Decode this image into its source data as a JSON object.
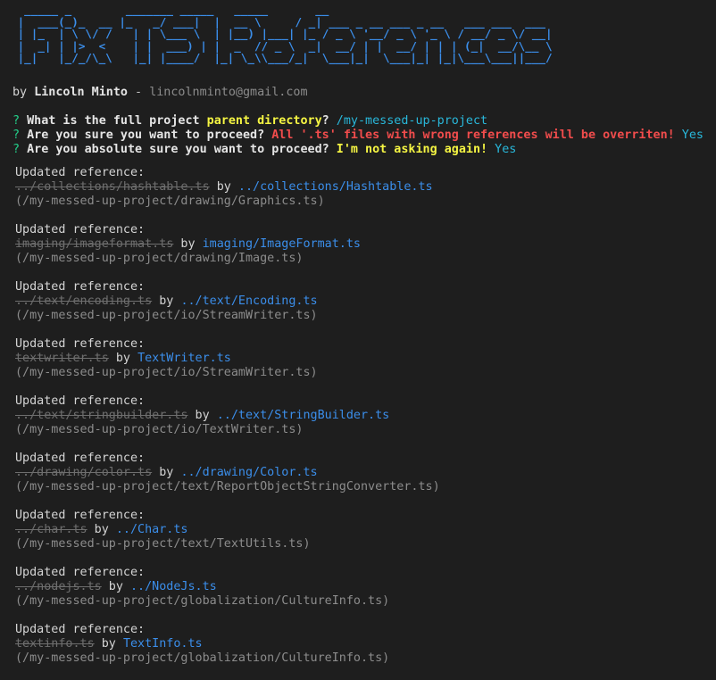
{
  "banner": {
    "title": "Fix TS References"
  },
  "author": {
    "prefix": "by ",
    "name": "Lincoln Minto",
    "separator": " - ",
    "email": "lincolnminto@gmail.com"
  },
  "prompts": [
    {
      "mark": "?",
      "question": " What is the full project ",
      "highlight": "parent directory",
      "question_end": "?",
      "answer": " /my-messed-up-project"
    },
    {
      "mark": "?",
      "question": " Are you sure you want to proceed? ",
      "warning": "All '.ts' files with wrong references will be overriten!",
      "answer": " Yes"
    },
    {
      "mark": "?",
      "question": " Are you absolute sure you want to proceed? ",
      "highlight": "I'm not asking again!",
      "answer": " Yes"
    }
  ],
  "entries": [
    {
      "heading": "Updated reference:",
      "old": "../collections/hashtable.ts",
      "by": " by ",
      "new": "../collections/Hashtable.ts",
      "file": "(/my-messed-up-project/drawing/Graphics.ts)"
    },
    {
      "heading": "Updated reference:",
      "old": "imaging/imageformat.ts",
      "by": " by ",
      "new": "imaging/ImageFormat.ts",
      "file": "(/my-messed-up-project/drawing/Image.ts)"
    },
    {
      "heading": "Updated reference:",
      "old": "../text/encoding.ts",
      "by": " by ",
      "new": "../text/Encoding.ts",
      "file": "(/my-messed-up-project/io/StreamWriter.ts)"
    },
    {
      "heading": "Updated reference:",
      "old": "textwriter.ts",
      "by": " by ",
      "new": "TextWriter.ts",
      "file": "(/my-messed-up-project/io/StreamWriter.ts)"
    },
    {
      "heading": "Updated reference:",
      "old": "../text/stringbuilder.ts",
      "by": " by ",
      "new": "../text/StringBuilder.ts",
      "file": "(/my-messed-up-project/io/TextWriter.ts)"
    },
    {
      "heading": "Updated reference:",
      "old": "../drawing/color.ts",
      "by": " by ",
      "new": "../drawing/Color.ts",
      "file": "(/my-messed-up-project/text/ReportObjectStringConverter.ts)"
    },
    {
      "heading": "Updated reference:",
      "old": "../char.ts",
      "by": " by ",
      "new": "../Char.ts",
      "file": "(/my-messed-up-project/text/TextUtils.ts)"
    },
    {
      "heading": "Updated reference:",
      "old": "../nodejs.ts",
      "by": " by ",
      "new": "../NodeJs.ts",
      "file": "(/my-messed-up-project/globalization/CultureInfo.ts)"
    },
    {
      "heading": "Updated reference:",
      "old": "textinfo.ts",
      "by": " by ",
      "new": "TextInfo.ts",
      "file": "(/my-messed-up-project/globalization/CultureInfo.ts)"
    }
  ],
  "colors": {
    "background": "#1e1e1e",
    "banner": "#3b8eea",
    "prompt_mark": "#23d18b",
    "highlight": "#f5f543",
    "warning": "#f14c4c",
    "answer": "#29b8db",
    "new_reference": "#3b8eea",
    "old_reference": "#6e6e6e",
    "muted": "#8c8c8c"
  }
}
